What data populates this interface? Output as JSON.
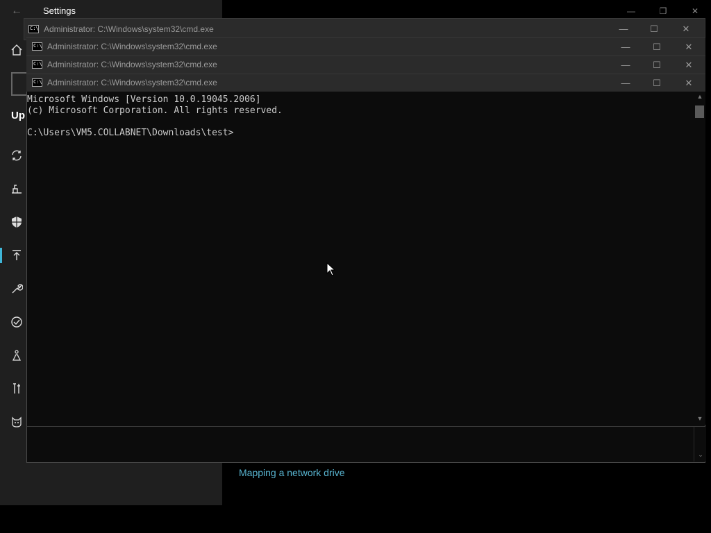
{
  "settings": {
    "title": "Settings",
    "back_icon": "arrow-left-icon",
    "controls": [
      "—",
      "❐",
      "✕"
    ],
    "nav_partial_label": "Up",
    "nav_icons": [
      "home-icon",
      "sync-icon",
      "delivery-icon",
      "shield-icon",
      "upload-icon",
      "wrench-icon",
      "check-circle-icon",
      "person-flask-icon",
      "tools-icon",
      "cat-icon"
    ],
    "link": "Mapping a network drive",
    "accent": "#3fb6d8"
  },
  "cmd_windows": [
    {
      "title": "Administrator: C:\\Windows\\system32\\cmd.exe",
      "icon_text": "C:\\"
    },
    {
      "title": "Administrator: C:\\Windows\\system32\\cmd.exe",
      "icon_text": "C:\\"
    },
    {
      "title": "Administrator: C:\\Windows\\system32\\cmd.exe",
      "icon_text": "C:\\"
    },
    {
      "title": "Administrator: C:\\Windows\\system32\\cmd.exe",
      "icon_text": "C:\\"
    }
  ],
  "window_controls": {
    "minimize": "—",
    "maximize": "☐",
    "close": "✕"
  },
  "console": {
    "lines": [
      "Microsoft Windows [Version 10.0.19045.2006]",
      "(c) Microsoft Corporation. All rights reserved.",
      "",
      "C:\\Users\\VM5.COLLABNET\\Downloads\\test>"
    ]
  },
  "scroll": {
    "up": "▲",
    "down": "▼",
    "bottom_down": "⌄"
  }
}
